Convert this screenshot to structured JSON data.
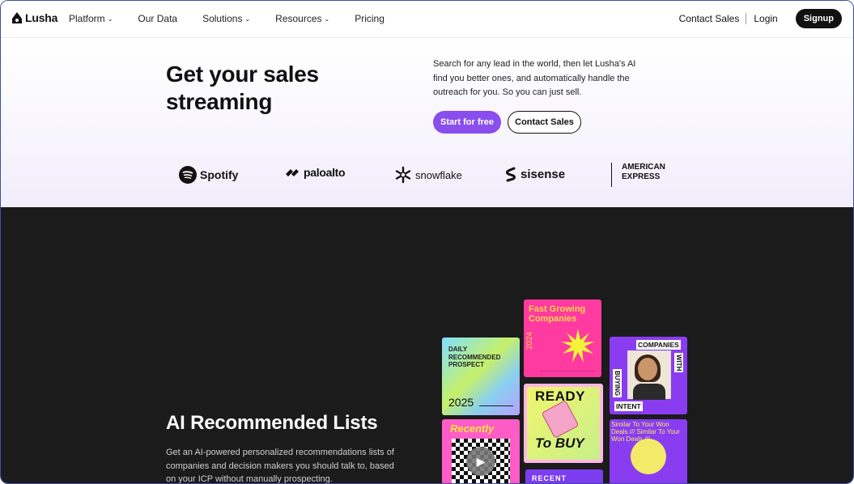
{
  "nav": {
    "logo": "Lusha",
    "links": [
      "Platform",
      "Our Data",
      "Solutions",
      "Resources",
      "Pricing"
    ],
    "contact": "Contact Sales",
    "login": "Login",
    "signup": "Signup"
  },
  "hero": {
    "title": "Get your sales streaming",
    "description": "Search for any lead in the world, then let Lusha's AI find you better ones, and automatically handle the outreach for you. So you can just sell.",
    "primary_cta": "Start for free",
    "secondary_cta": "Contact Sales",
    "brand_logos": [
      "Spotify",
      "paloalto",
      "snowflake",
      "sisense",
      "AMERICAN",
      "EXPRESS"
    ]
  },
  "feature": {
    "title": "AI Recommended Lists",
    "description": "Get an AI-powered personalized recommendations lists of companies and decision makers you should talk to, based on your ICP without manually prospecting."
  },
  "cards": {
    "daily": "DAILY RECOMMENDED PROSPECT",
    "daily_year": "2025",
    "fast": "Fast Growing Companies",
    "fast_year": "2024",
    "ready_top": "READY",
    "ready_bottom": "To BUY",
    "companies_top": "COMPANIES",
    "companies_side": "WITH",
    "companies_left": "BUYING",
    "companies_bottom": "INTENT",
    "recent": "Recently",
    "won": "Similar To Your Won Deals /// Similar To Your Won Deals ///",
    "bottom": "RECENT"
  },
  "colors": {
    "primary": "#8a4dee",
    "dark_bg": "#1b1b1b",
    "pink": "#ff3aa0",
    "purple": "#8a3cf0",
    "yellow": "#ffd84a"
  }
}
